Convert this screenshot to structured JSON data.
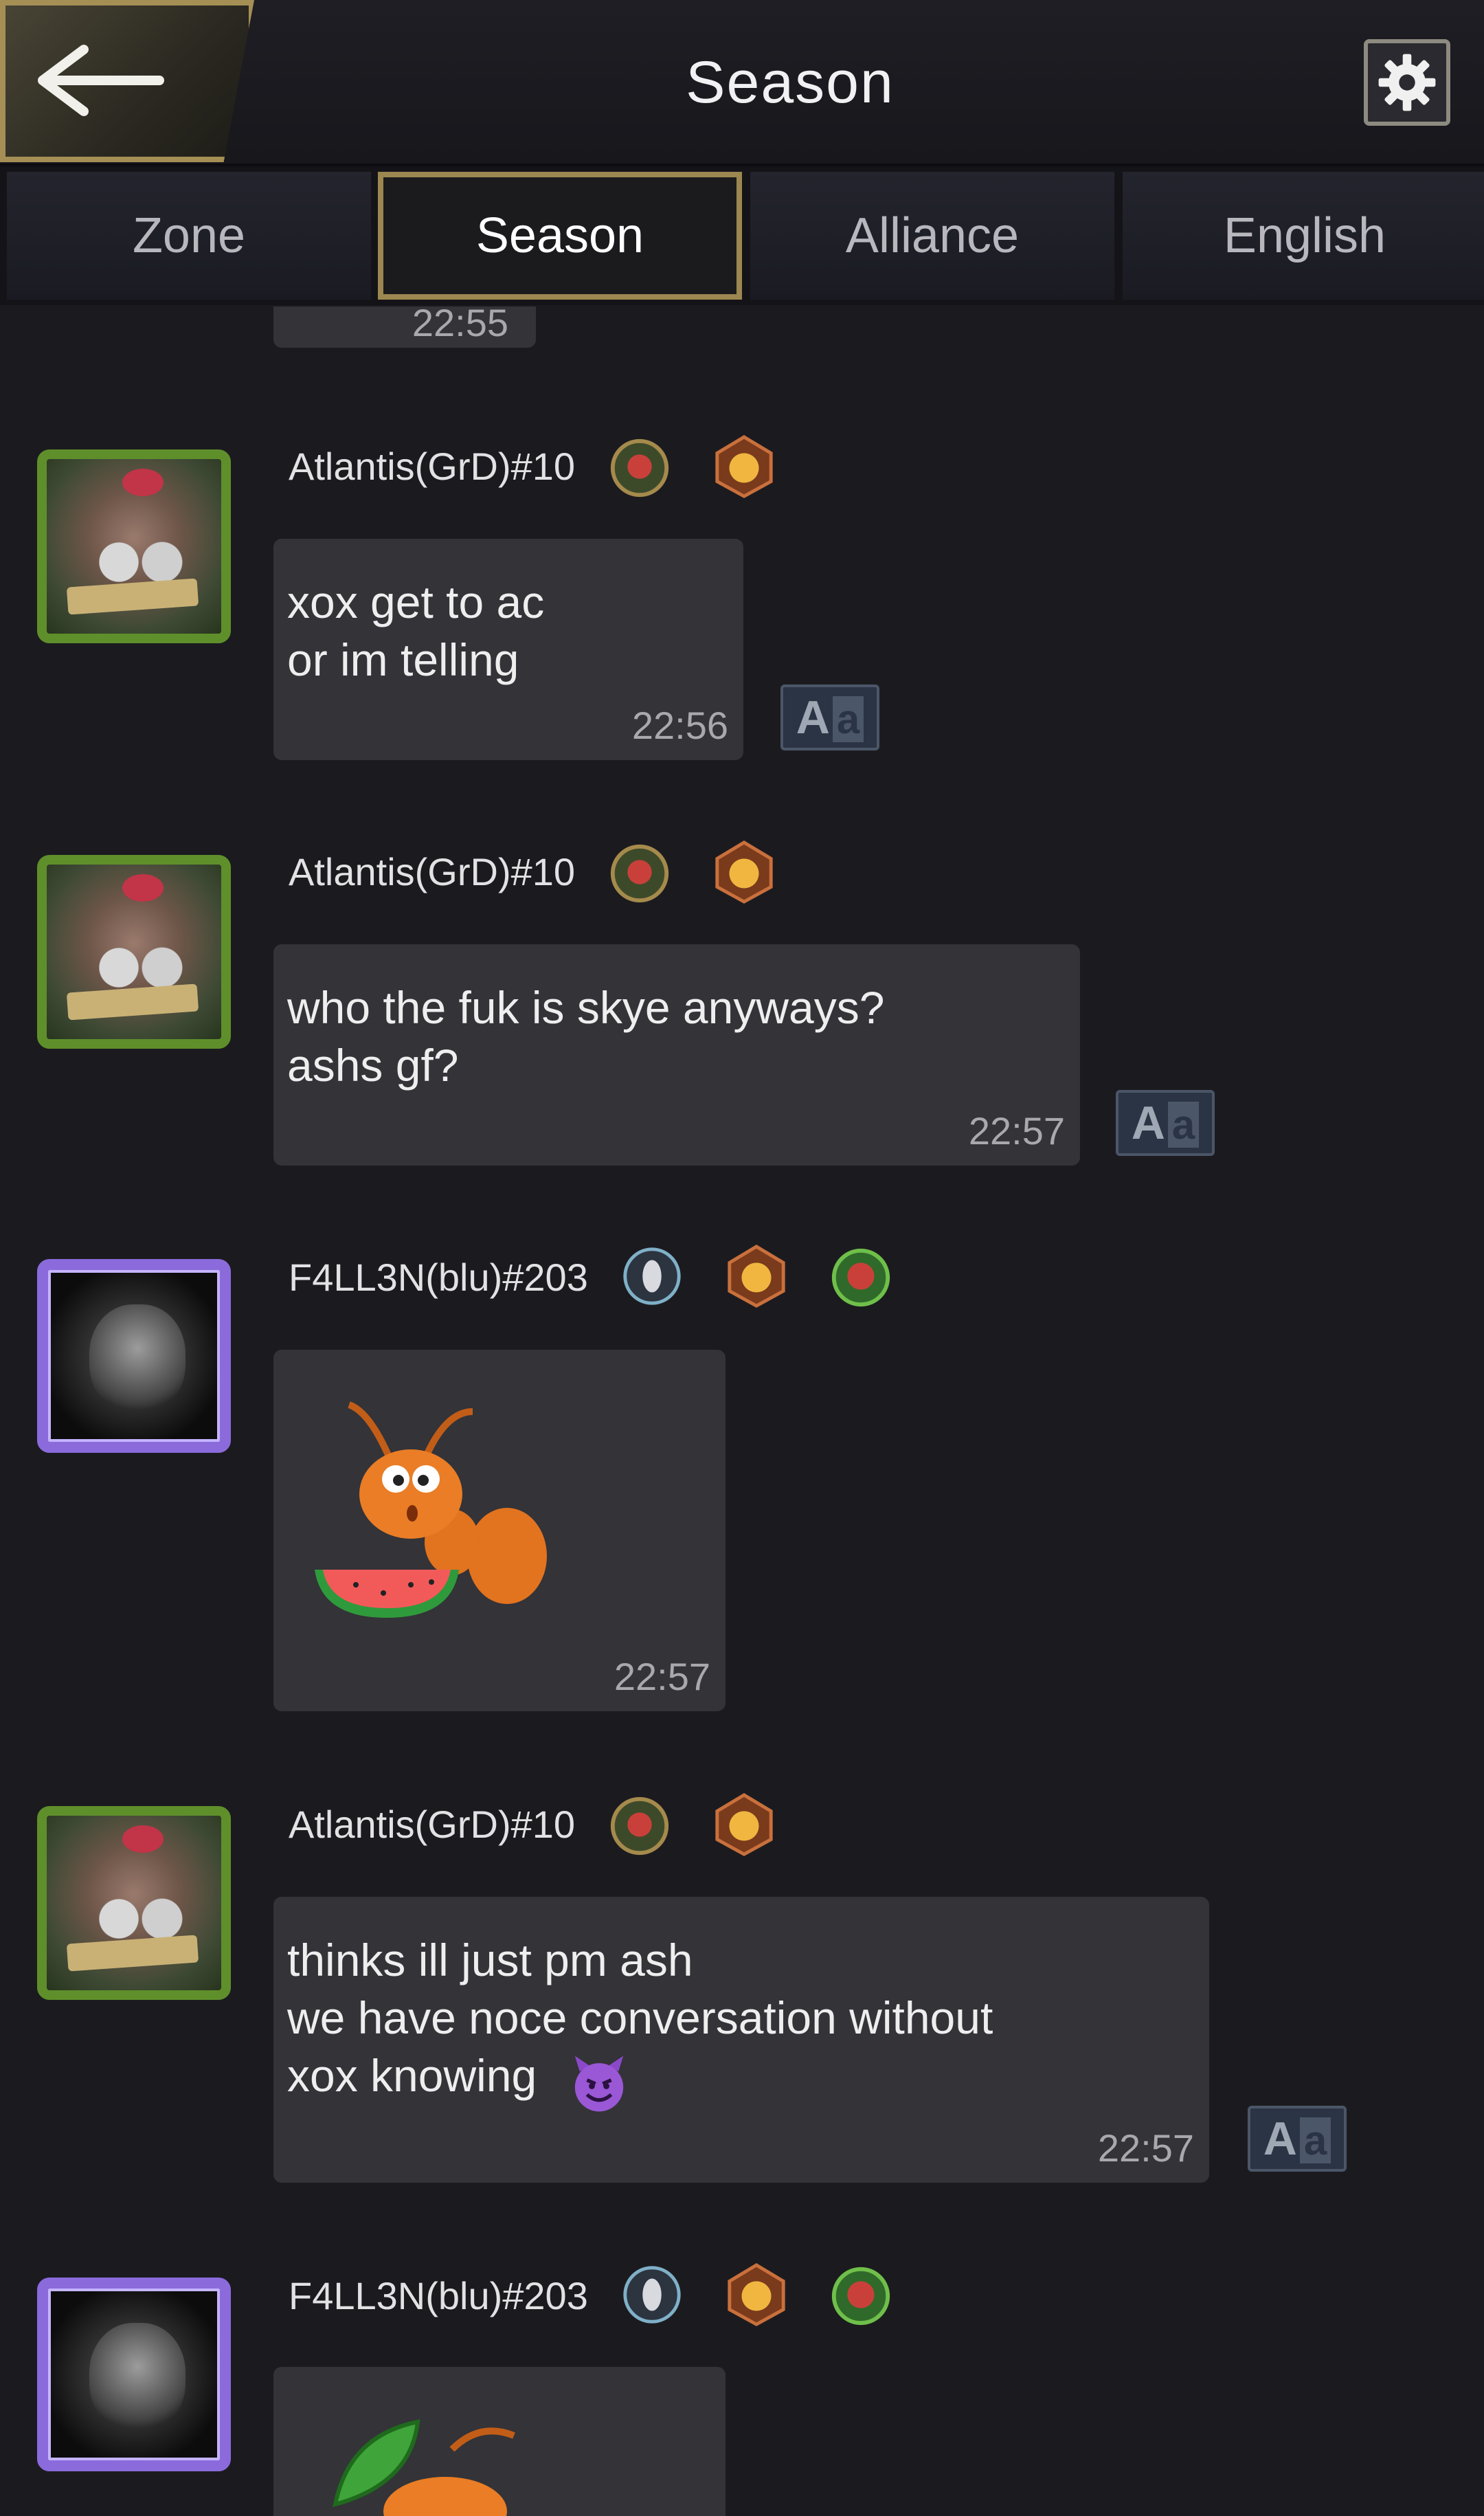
{
  "header": {
    "title": "Season"
  },
  "tabs": [
    {
      "label": "Zone"
    },
    {
      "label": "Season"
    },
    {
      "label": "Alliance"
    },
    {
      "label": "English"
    }
  ],
  "top_partial": {
    "time": "22:55"
  },
  "translate_label": {
    "big": "A",
    "small": "a"
  },
  "messages": [
    {
      "name": "Atlantis(GrD)#10",
      "text": "xox get to ac\nor im telling",
      "time": "22:56"
    },
    {
      "name": "Atlantis(GrD)#10",
      "text": "who the fuk is skye anyways?\nashs gf?",
      "time": "22:57"
    },
    {
      "name": "F4LL3N(blu)#203",
      "sticker": "ant-eating-watermelon",
      "time": "22:57"
    },
    {
      "name": "Atlantis(GrD)#10",
      "text": "thinks ill just pm ash\nwe have noce conversation without\nxox knowing",
      "emoji": "smiling-devil",
      "time": "22:57"
    },
    {
      "name": "F4LL3N(blu)#203",
      "sticker": "ant-with-leaf"
    }
  ],
  "icons": [
    "back-arrow-icon",
    "gear-icon",
    "badge-icon",
    "translate-icon"
  ],
  "colors": {
    "accent_gold": "#9c8750",
    "bubble": "#333338",
    "background": "#1b1b1f"
  }
}
